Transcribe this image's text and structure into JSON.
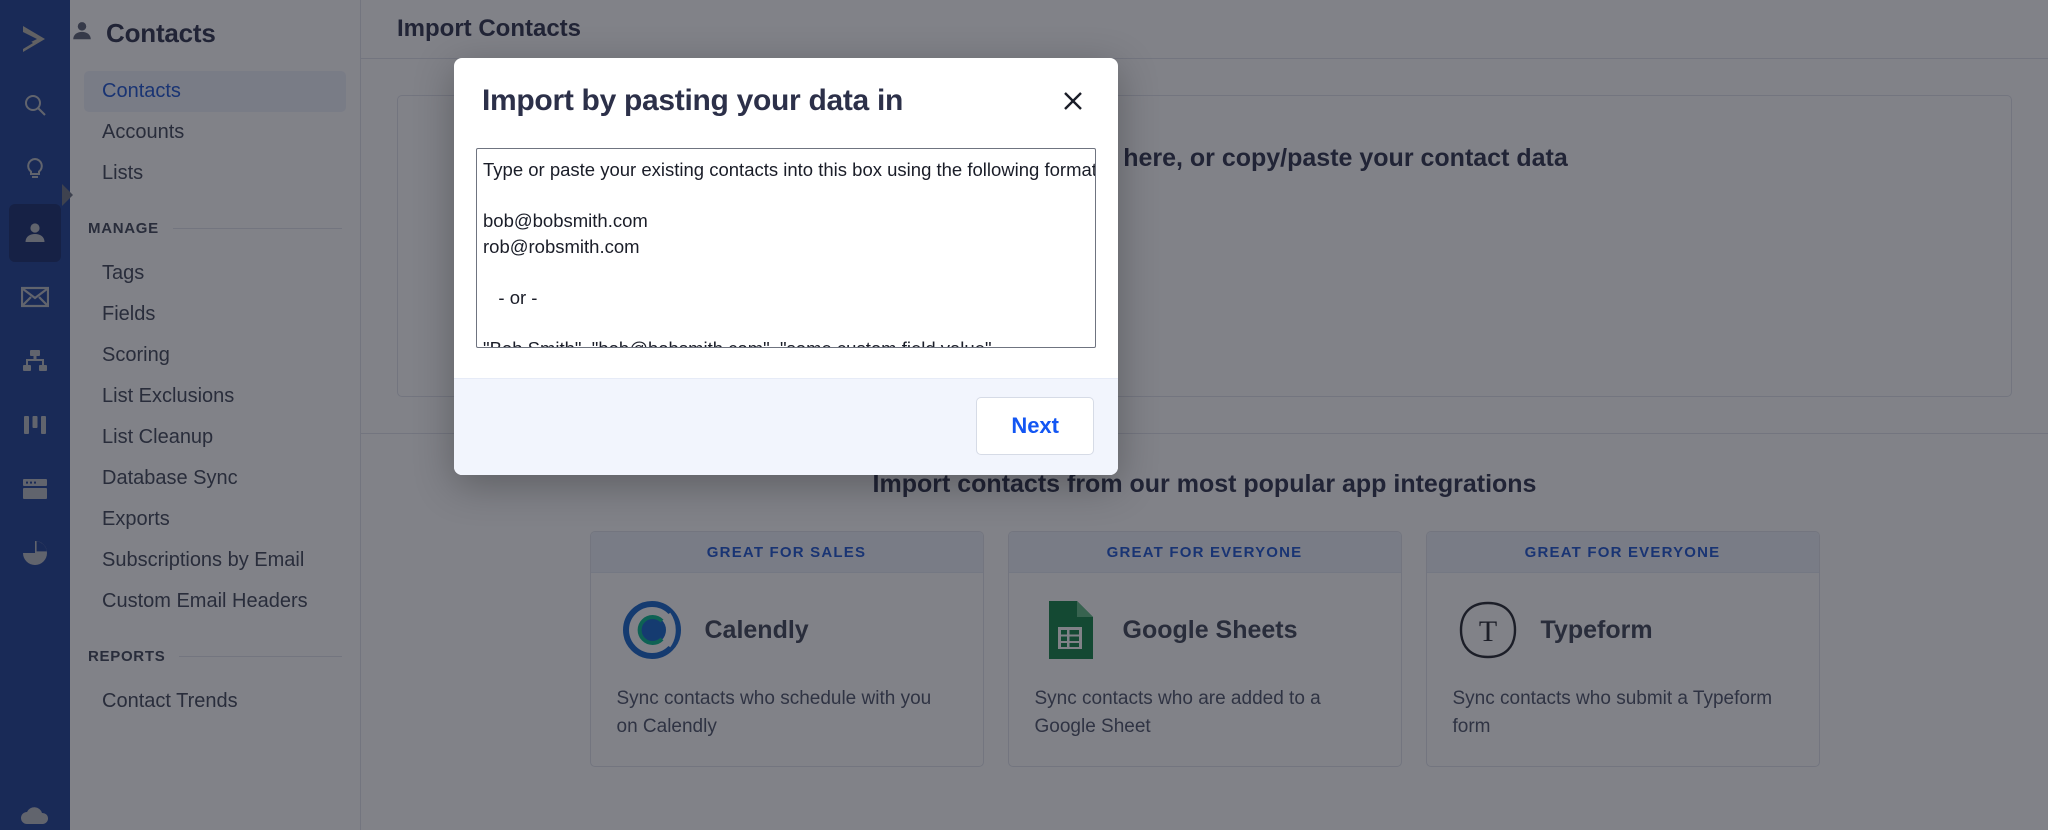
{
  "rail": {
    "logo_icon": "activecampaign-logo-icon",
    "items": [
      {
        "icon": "search-icon",
        "name": "search"
      },
      {
        "icon": "lightbulb-icon",
        "name": "deals"
      },
      {
        "icon": "person-icon",
        "name": "contacts",
        "active": true
      },
      {
        "icon": "envelope-icon",
        "name": "campaigns"
      },
      {
        "icon": "sitemap-icon",
        "name": "automations"
      },
      {
        "icon": "columns-icon",
        "name": "pipelines"
      },
      {
        "icon": "window-icon",
        "name": "website"
      },
      {
        "icon": "piechart-icon",
        "name": "reports"
      }
    ],
    "bottom_icon": "cloud-icon"
  },
  "subnav": {
    "icon": "person-icon",
    "title": "Contacts",
    "items": [
      {
        "label": "Contacts",
        "selected": true
      },
      {
        "label": "Accounts",
        "selected": false
      },
      {
        "label": "Lists",
        "selected": false
      }
    ],
    "manage_label": "MANAGE",
    "manage_items": [
      {
        "label": "Tags"
      },
      {
        "label": "Fields"
      },
      {
        "label": "Scoring"
      },
      {
        "label": "List Exclusions"
      },
      {
        "label": "List Cleanup"
      },
      {
        "label": "Database Sync"
      },
      {
        "label": "Exports"
      },
      {
        "label": "Subscriptions by Email"
      },
      {
        "label": "Custom Email Headers"
      }
    ],
    "reports_label": "REPORTS",
    "reports_items": [
      {
        "label": "Contact Trends"
      }
    ]
  },
  "main": {
    "header_title": "Import Contacts",
    "panel_lead": "Drag and drop your file here, or copy/paste your contact data",
    "integrations_title": "Import contacts from our most popular app integrations",
    "cards": [
      {
        "banner": "GREAT FOR SALES",
        "name": "Calendly",
        "logo": "calendly-logo-icon",
        "desc": "Sync contacts who schedule with you on Calendly"
      },
      {
        "banner": "GREAT FOR EVERYONE",
        "name": "Google Sheets",
        "logo": "google-sheets-logo-icon",
        "desc": "Sync contacts who are added to a Google Sheet"
      },
      {
        "banner": "GREAT FOR EVERYONE",
        "name": "Typeform",
        "logo": "typeform-logo-icon",
        "desc": "Sync contacts who submit a Typeform form"
      }
    ]
  },
  "modal": {
    "title": "Import by pasting your data in",
    "close_icon": "close-icon",
    "paste_value": "Type or paste your existing contacts into this box using the following format:\n\nbob@bobsmith.com\nrob@robsmith.com\n\n   - or -\n\n\"Bob Smith\", \"bob@bobsmith.com\", \"some custom field value\"\n\"Rob Smith\", \"rob@robsmith.com\", \"some custom field value\"",
    "paste_placeholder": "Type or paste your existing contacts into this box using the following format:",
    "next_label": "Next"
  },
  "colors": {
    "rail_bg": "#1a3c93",
    "rail_active": "#12296b",
    "accent_blue": "#1a52d0",
    "button_blue": "#1356f3",
    "heading": "#2c3049",
    "modal_footer": "#f2f5fd"
  }
}
